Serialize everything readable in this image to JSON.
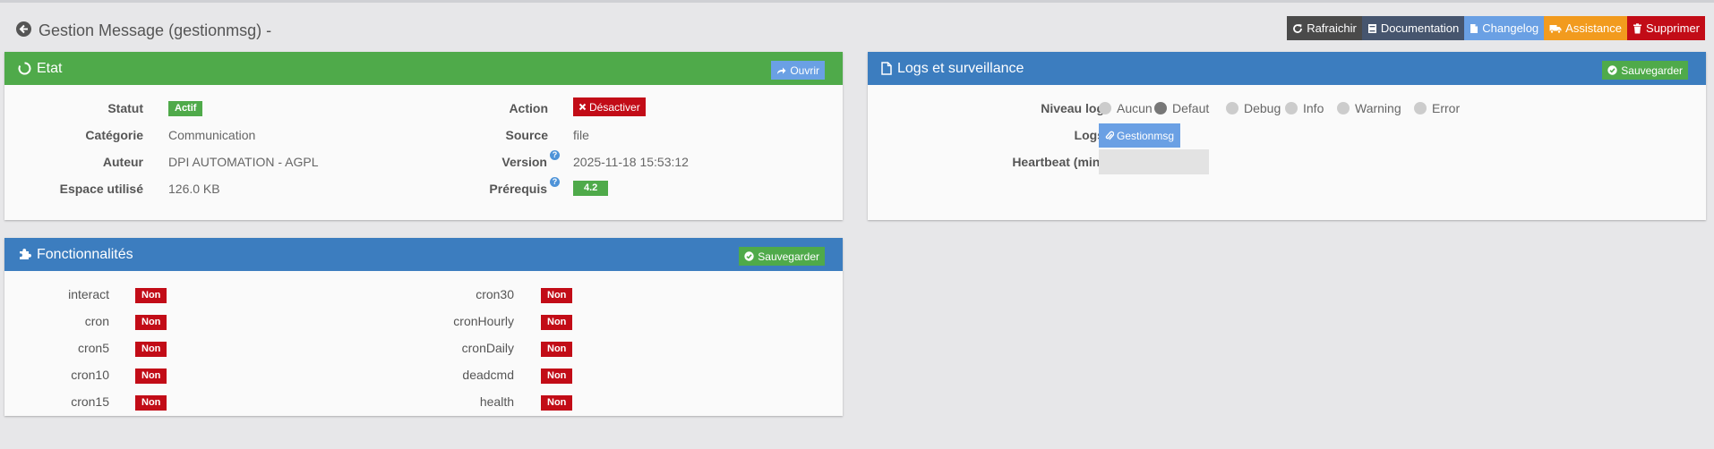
{
  "header": {
    "title": "Gestion Message (gestionmsg) -",
    "buttons": {
      "refresh": "Rafraichir",
      "documentation": "Documentation",
      "changelog": "Changelog",
      "assistance": "Assistance",
      "delete": "Supprimer"
    }
  },
  "etat": {
    "title": "Etat",
    "open_button": "Ouvrir",
    "labels": {
      "statut": "Statut",
      "categorie": "Catégorie",
      "auteur": "Auteur",
      "espace": "Espace utilisé",
      "action": "Action",
      "source": "Source",
      "version": "Version",
      "prerequis": "Prérequis"
    },
    "values": {
      "statut": "Actif",
      "categorie": "Communication",
      "auteur": "DPI AUTOMATION - AGPL",
      "espace": "126.0 KB",
      "action_button": "Désactiver",
      "source": "file",
      "version": "2025-11-18 15:53:12",
      "prerequis": "4.2"
    },
    "help_mark": "?"
  },
  "logs": {
    "title": "Logs et surveillance",
    "save_button": "Sauvegarder",
    "labels": {
      "niveau": "Niveau log",
      "logs": "Logs",
      "heartbeat": "Heartbeat (min)"
    },
    "levels": [
      "Aucun",
      "Defaut",
      "Debug",
      "Info",
      "Warning",
      "Error"
    ],
    "selected_level": "Defaut",
    "logs_button": "Gestionmsg",
    "heartbeat_value": ""
  },
  "fonctionnalites": {
    "title": "Fonctionnalités",
    "save_button": "Sauvegarder",
    "left": [
      {
        "name": "interact",
        "status": "Non"
      },
      {
        "name": "cron",
        "status": "Non"
      },
      {
        "name": "cron5",
        "status": "Non"
      },
      {
        "name": "cron10",
        "status": "Non"
      },
      {
        "name": "cron15",
        "status": "Non"
      }
    ],
    "right": [
      {
        "name": "cron30",
        "status": "Non"
      },
      {
        "name": "cronHourly",
        "status": "Non"
      },
      {
        "name": "cronDaily",
        "status": "Non"
      },
      {
        "name": "deadcmd",
        "status": "Non"
      },
      {
        "name": "health",
        "status": "Non"
      }
    ]
  },
  "colors": {
    "green": "#4faa4a",
    "blue": "#3c7dbf",
    "red": "#c20c17",
    "orange": "#f29b1e",
    "light_blue": "#6aa0e4",
    "background": "#e7e7e9"
  },
  "icons": {
    "back": "arrow-circle-left-icon",
    "refresh": "refresh-icon",
    "documentation": "book-icon",
    "changelog": "file-icon",
    "assistance": "truck-icon",
    "delete": "trash-icon",
    "etat": "circle-notch-icon",
    "logs": "file-icon",
    "fonctionnalites": "puzzle-icon"
  }
}
